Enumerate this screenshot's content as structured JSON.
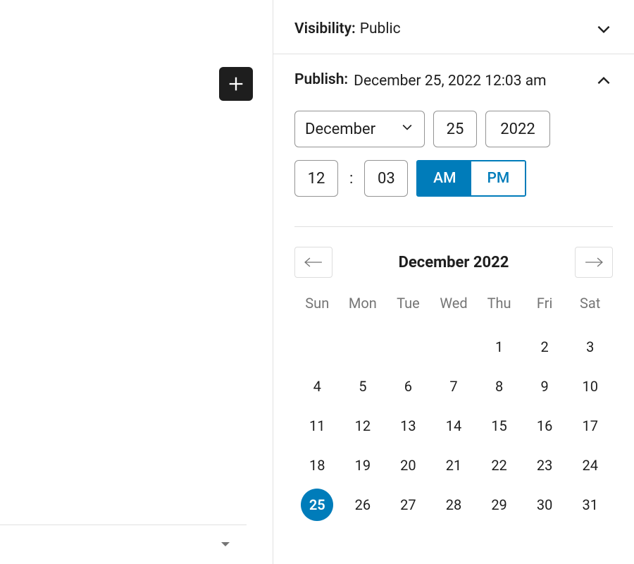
{
  "visibility": {
    "label": "Visibility:",
    "value": "Public"
  },
  "publish": {
    "label": "Publish:",
    "datetime_display": "December 25, 2022 12:03 am",
    "month": "December",
    "day": "25",
    "year": "2022",
    "hour": "12",
    "minute": "03",
    "colon": ":",
    "ampm": {
      "am": "AM",
      "pm": "PM",
      "selected": "AM"
    }
  },
  "calendar": {
    "title": "December 2022",
    "dow": [
      "Sun",
      "Mon",
      "Tue",
      "Wed",
      "Thu",
      "Fri",
      "Sat"
    ],
    "leading_blanks": 4,
    "days": [
      1,
      2,
      3,
      4,
      5,
      6,
      7,
      8,
      9,
      10,
      11,
      12,
      13,
      14,
      15,
      16,
      17,
      18,
      19,
      20,
      21,
      22,
      23,
      24,
      25,
      26,
      27,
      28,
      29,
      30,
      31
    ],
    "selected_day": 25
  }
}
